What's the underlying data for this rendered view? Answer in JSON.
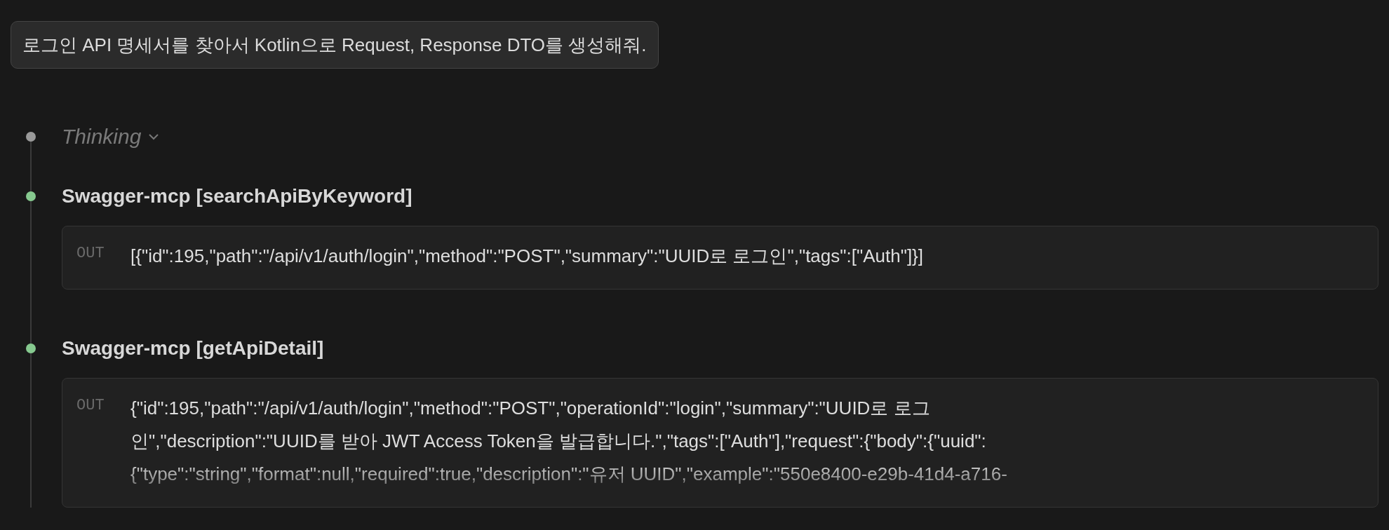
{
  "prompt": "로그인 API 명세서를 찾아서 Kotlin으로 Request, Response DTO를 생성해줘.",
  "steps": [
    {
      "kind": "thinking",
      "title": "Thinking",
      "expanded": false,
      "color": "#9a9a9a"
    },
    {
      "kind": "tool",
      "title": "Swagger-mcp [searchApiByKeyword]",
      "color": "#86c98f",
      "output_label": "OUT",
      "output_lines": [
        "[{\"id\":195,\"path\":\"/api/v1/auth/login\",\"method\":\"POST\",\"summary\":\"UUID로 로그인\",\"tags\":[\"Auth\"]}]"
      ]
    },
    {
      "kind": "tool",
      "title": "Swagger-mcp [getApiDetail]",
      "color": "#86c98f",
      "output_label": "OUT",
      "output_lines": [
        "{\"id\":195,\"path\":\"/api/v1/auth/login\",\"method\":\"POST\",\"operationId\":\"login\",\"summary\":\"UUID로 로그",
        "인\",\"description\":\"UUID를 받아 JWT Access Token을 발급합니다.\",\"tags\":[\"Auth\"],\"request\":{\"body\":{\"uuid\":",
        "{\"type\":\"string\",\"format\":null,\"required\":true,\"description\":\"유저 UUID\",\"example\":\"550e8400-e29b-41d4-a716-"
      ]
    }
  ]
}
